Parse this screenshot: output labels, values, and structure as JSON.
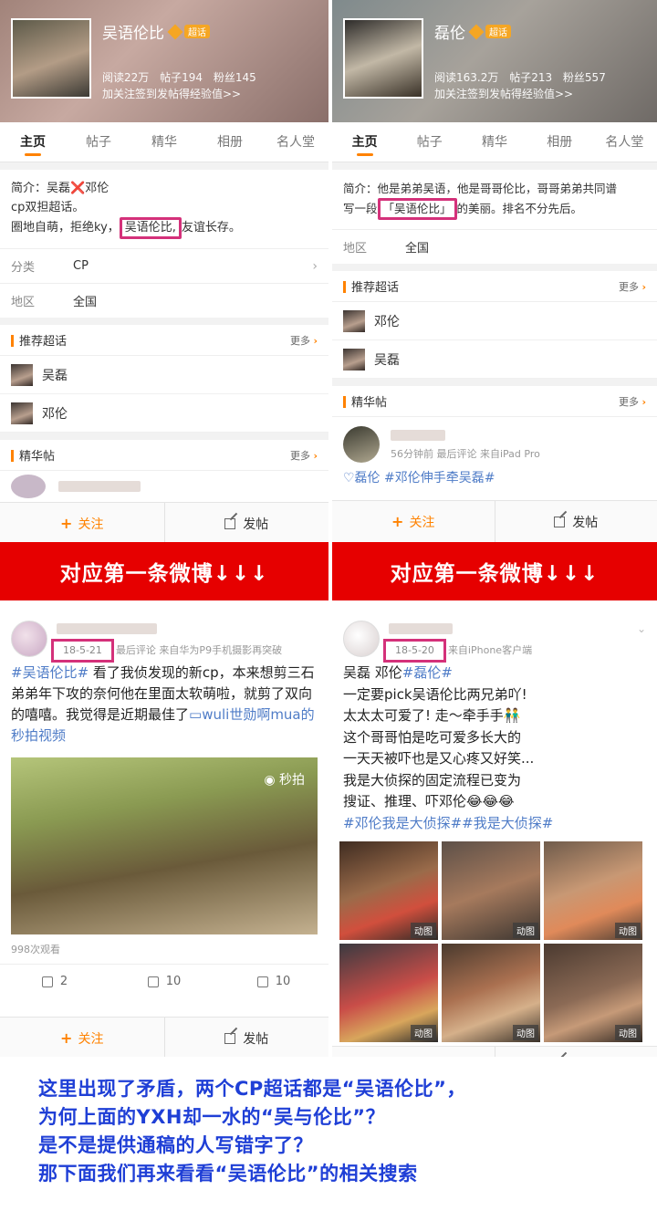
{
  "left": {
    "header": {
      "name": "吴语伦比",
      "badge": "超话",
      "reads": "阅读22万",
      "posts": "帖子194",
      "fans": "粉丝145",
      "sign": "加关注签到发帖得经验值>>"
    },
    "tabs": [
      "主页",
      "帖子",
      "精华",
      "相册",
      "名人堂"
    ],
    "intro": {
      "prefix": "简介：吴磊",
      "x": "❌",
      "suffix": "邓伦",
      "line2": "cp双担超话。",
      "line3a": "圈地自萌，拒绝ky，",
      "highlight": "吴语伦比,",
      "line3b": "友谊长存。"
    },
    "category": {
      "key": "分类",
      "value": "CP"
    },
    "region": {
      "key": "地区",
      "value": "全国"
    },
    "recommend": {
      "title": "推荐超话",
      "more": "更多",
      "people": [
        "吴磊",
        "邓伦"
      ]
    },
    "featured": {
      "title": "精华帖",
      "more": "更多"
    },
    "actions": {
      "follow": "关注",
      "post": "发帖"
    },
    "banner": "对应第一条微博↓↓↓",
    "weibo": {
      "date": "18-5-21",
      "meta": "最后评论  来自华为P9手机摄影再突破",
      "tag": "#吴语伦比#",
      "text": " 看了我侦发现的新cp，本来想剪三石弟弟年下攻的奈何他在里面太软萌啦，就剪了双向的嘻嘻。我觉得是近期最佳了",
      "link": "wuli世勋啊mua的秒拍视频",
      "video_mark": "秒拍",
      "views": "998次观看",
      "forward": "2",
      "comment": "10",
      "like": "10"
    }
  },
  "right": {
    "header": {
      "name": "磊伦",
      "badge": "超话",
      "reads": "阅读163.2万",
      "posts": "帖子213",
      "fans": "粉丝557",
      "sign": "加关注签到发帖得经验值>>"
    },
    "tabs": [
      "主页",
      "帖子",
      "精华",
      "相册",
      "名人堂"
    ],
    "intro": {
      "line1": "简介：他是弟弟吴语，他是哥哥伦比，哥哥弟弟共同谱",
      "line2a": "写一段",
      "highlight": "「吴语伦比」",
      "line2b": "的美丽。排名不分先后。"
    },
    "region": {
      "key": "地区",
      "value": "全国"
    },
    "recommend": {
      "title": "推荐超话",
      "more": "更多",
      "people": [
        "邓伦",
        "吴磊"
      ]
    },
    "featured": {
      "title": "精华帖",
      "more": "更多",
      "peek_meta": "56分钟前 最后评论  来自iPad Pro",
      "peek_tags": "♡磊伦  #邓伦伸手牵吴磊#"
    },
    "actions": {
      "follow": "关注",
      "post": "发帖"
    },
    "banner": "对应第一条微博↓↓↓",
    "weibo": {
      "date": "18-5-20",
      "meta": "来自iPhone客户端",
      "line1a": "吴磊 邓伦",
      "line1tag": "#磊伦#",
      "line2": "一定要pick吴语伦比两兄弟吖!",
      "line3": "太太太可爱了! 走～牵手手👬",
      "line4": "这个哥哥怕是吃可爱多长大的",
      "line5": "一天天被吓也是又心疼又好笑...",
      "line6": "我是大侦探的固定流程已变为",
      "line7": "搜证、推理、吓邓伦😂😂😂",
      "line8tag": "#邓伦我是大侦探##我是大侦探#",
      "gif_label": "动图"
    }
  },
  "note": {
    "line1": "这里出现了矛盾，两个CP超话都是“吴语伦比”，",
    "line2": "为何上面的YXH却一水的“吴与伦比”？",
    "line3": "是不是提供通稿的人写错字了？",
    "line4": "那下面我们再来看看“吴语伦比”的相关搜索"
  },
  "colors": {
    "accent": "#ff8200",
    "highlight_box": "#d4317a",
    "banner": "#e60000",
    "note_text": "#1f3fd6",
    "hashtag": "#4f7cc7"
  }
}
